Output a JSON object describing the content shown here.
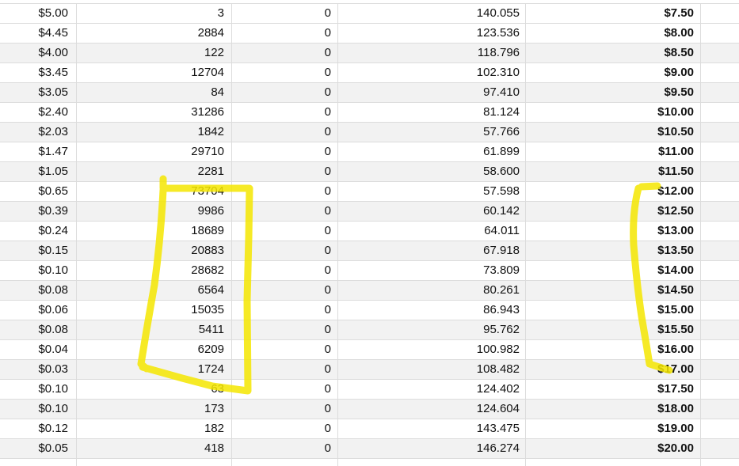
{
  "spreadsheet": {
    "rows": [
      [
        "$5.00",
        "3",
        "0",
        "140.055",
        "$7.50"
      ],
      [
        "$4.45",
        "2884",
        "0",
        "123.536",
        "$8.00"
      ],
      [
        "$4.00",
        "122",
        "0",
        "118.796",
        "$8.50"
      ],
      [
        "$3.45",
        "12704",
        "0",
        "102.310",
        "$9.00"
      ],
      [
        "$3.05",
        "84",
        "0",
        "97.410",
        "$9.50"
      ],
      [
        "$2.40",
        "31286",
        "0",
        "81.124",
        "$10.00"
      ],
      [
        "$2.03",
        "1842",
        "0",
        "57.766",
        "$10.50"
      ],
      [
        "$1.47",
        "29710",
        "0",
        "61.899",
        "$11.00"
      ],
      [
        "$1.05",
        "2281",
        "0",
        "58.600",
        "$11.50"
      ],
      [
        "$0.65",
        "73704",
        "0",
        "57.598",
        "$12.00"
      ],
      [
        "$0.39",
        "9986",
        "0",
        "60.142",
        "$12.50"
      ],
      [
        "$0.24",
        "18689",
        "0",
        "64.011",
        "$13.00"
      ],
      [
        "$0.15",
        "20883",
        "0",
        "67.918",
        "$13.50"
      ],
      [
        "$0.10",
        "28682",
        "0",
        "73.809",
        "$14.00"
      ],
      [
        "$0.08",
        "6564",
        "0",
        "80.261",
        "$14.50"
      ],
      [
        "$0.06",
        "15035",
        "0",
        "86.943",
        "$15.00"
      ],
      [
        "$0.08",
        "5411",
        "0",
        "95.762",
        "$15.50"
      ],
      [
        "$0.04",
        "6209",
        "0",
        "100.982",
        "$16.00"
      ],
      [
        "$0.03",
        "1724",
        "0",
        "108.482",
        "$17.00"
      ],
      [
        "$0.10",
        "63",
        "0",
        "124.402",
        "$17.50"
      ],
      [
        "$0.10",
        "173",
        "0",
        "124.604",
        "$18.00"
      ],
      [
        "$0.12",
        "182",
        "0",
        "143.475",
        "$19.00"
      ],
      [
        "$0.05",
        "418",
        "0",
        "146.274",
        "$20.00"
      ]
    ]
  },
  "annotation": {
    "highlight_color": "#f5e600"
  }
}
